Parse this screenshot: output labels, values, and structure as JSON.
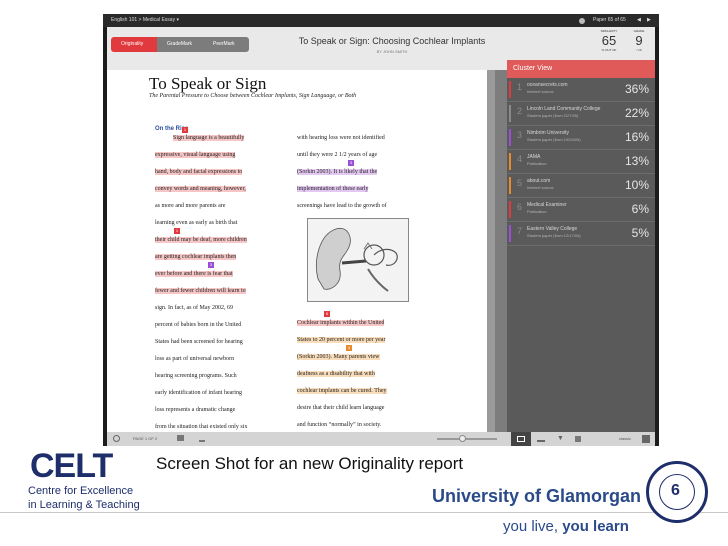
{
  "topbar": {
    "course": "English 101 > Medical Essay ▾",
    "paper_nav": "Paper 65 of 65"
  },
  "header": {
    "modes": [
      "Originality",
      "GradeMark",
      "PeerMark"
    ],
    "paper_title": "To Speak or Sign: Choosing Cochlear Implants",
    "author": "BY JOHN SMITH",
    "stats": [
      {
        "label": "SIMILARITY",
        "value": "65",
        "sub": "% OUT OF"
      },
      {
        "label": "GRADE",
        "value": "9",
        "sub": "/ 10"
      }
    ]
  },
  "paper": {
    "title": "To Speak or Sign",
    "subtitle": "The Parental Pressure to Choose between Cochlear Implants, Sign Language, or Both",
    "section": "On the Rise",
    "left_lines": [
      "Sign language is a beautifully",
      "expressive, visual language using",
      "hand, body and facial expressions to",
      "convey words and meaning, however,",
      "as more and more parents are",
      "learning even as early as birth that",
      "their child may be deaf, more children",
      "are getting cochlear implants then",
      "ever before and there is fear that",
      "fewer and fewer children will learn to",
      "sign.   In fact, as of May 2002, 69",
      "percent of babies born in the United",
      "States had been screened for hearing",
      "loss as part of universal newborn",
      "hearing screening programs. Such",
      "early identification of infant hearing",
      "loss represents a dramatic change",
      "from the situation that existed only six"
    ],
    "right_top_lines": [
      "with hearing loss were not identified",
      "until they were 2 1/2 years of age",
      "(Sorkin 2003).  It is likely that the",
      "implementation of these early",
      "screenings have lead to the growth of"
    ],
    "right_bottom_lines": [
      "Cochlear implants within the United",
      "States to 20 percent or more per year",
      "(Sorkin 2003).  Many parents view",
      "deafness as a disability that with",
      "cochlear implants can be cured.  They",
      "desire that their child learn language",
      "and function “normally” in society."
    ]
  },
  "cluster": {
    "title": "Cluster View",
    "items": [
      {
        "num": "1",
        "source": "oceansecrets.com",
        "type": "Internet source",
        "pct": "36%",
        "color": "#e0393e"
      },
      {
        "num": "2",
        "source": "Lincoln Land Community College",
        "type": "Student paper (from 2/27/09)",
        "pct": "22%",
        "color": "#8a8a8a"
      },
      {
        "num": "3",
        "source": "Nimbrim University",
        "type": "Student paper (from 10/24/09)",
        "pct": "16%",
        "color": "#9b4fd6"
      },
      {
        "num": "4",
        "source": "JAMA",
        "type": "Publication",
        "pct": "13%",
        "color": "#e98a2d"
      },
      {
        "num": "5",
        "source": "about.com",
        "type": "Internet source",
        "pct": "10%",
        "color": "#e98a2d"
      },
      {
        "num": "6",
        "source": "Medical Examiner",
        "type": "Publication",
        "pct": "6%",
        "color": "#e0393e"
      },
      {
        "num": "7",
        "source": "Eastern Valley College",
        "type": "Student paper (from 12/17/04)",
        "pct": "5%",
        "color": "#9b4fd6"
      }
    ]
  },
  "bottombar": {
    "page": "PAGE 1 OF 2",
    "zoom": "classic"
  },
  "caption": "Screen Shot for an new Originality report",
  "footer": {
    "celt_logo": "CELT",
    "celt_line1": "Centre for Excellence",
    "celt_line2": "in Learning & Teaching",
    "university": "University of Glamorgan",
    "slogan_prefix": "you live, ",
    "slogan_bold": "you learn",
    "slide_number": "6",
    "seal_text": "UNIVERSITY OF GLAMORGAN"
  },
  "colors": {
    "red": "#e0393e",
    "purple": "#9b4fd6",
    "orange": "#e98a2d",
    "navy": "#1e2e6b"
  }
}
